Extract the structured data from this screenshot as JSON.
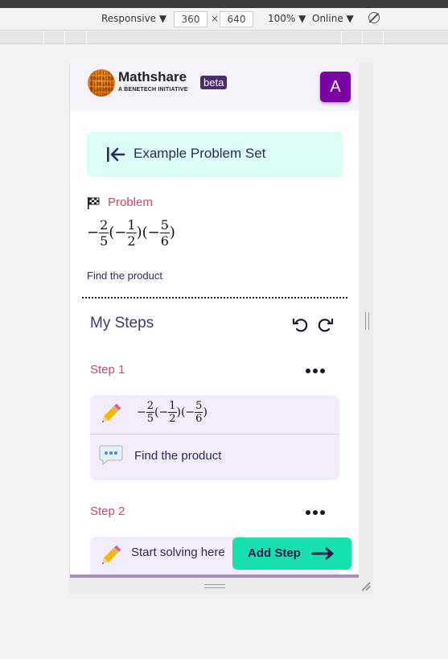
{
  "devtools": {
    "device": "Responsive ▼",
    "width": "360",
    "times": "×",
    "height": "640",
    "zoom": "100% ▼",
    "network": "Online ▼"
  },
  "header": {
    "brand": "Mathshare",
    "brand_sub": "A BENETECH INITIATIVE",
    "badge": "beta",
    "avatar_letter": "A"
  },
  "problem_set": {
    "title": "Example Problem Set"
  },
  "problem": {
    "label": "Problem",
    "text": "Find the product",
    "math": {
      "sign": "−",
      "f1_num": "2",
      "f1_den": "5",
      "open1": "(−",
      "f2_num": "1",
      "f2_den": "2",
      "mid": ")(−",
      "f3_num": "5",
      "f3_den": "6",
      "close": ")"
    }
  },
  "steps": {
    "title": "My Steps",
    "items": [
      {
        "label": "Step 1",
        "comment": "Find the product"
      },
      {
        "label": "Step 2",
        "placeholder": "Start solving here"
      }
    ]
  },
  "actions": {
    "add_step": "Add Step"
  },
  "colors": {
    "accent_teal": "#17dfb0",
    "step_pink": "#d64462",
    "avatar_purple": "#7a00a6",
    "card_lavender": "#f3ecfa",
    "banner_mint": "#dcfdf6"
  }
}
